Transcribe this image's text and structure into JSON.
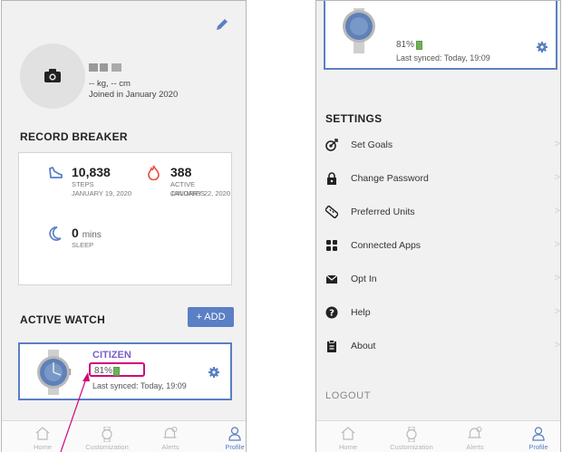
{
  "profile": {
    "stats_line": "-- kg, -- cm",
    "joined": "Joined in January 2020"
  },
  "record_breaker": {
    "title": "RECORD BREAKER",
    "steps": {
      "value": "10,838",
      "label": "STEPS",
      "date": "JANUARY 19, 2020"
    },
    "calories": {
      "value": "388",
      "label": "ACTIVE CALORIES",
      "date": "JANUARY 22, 2020"
    },
    "sleep": {
      "value": "0",
      "unit": "mins",
      "label": "SLEEP"
    }
  },
  "active_watch": {
    "title": "ACTIVE WATCH",
    "add_label": "+ ADD",
    "brand": "CITIZEN",
    "battery": "81%",
    "last_synced": "Last synced: Today, 19:09"
  },
  "settings": {
    "title": "SETTINGS",
    "items": [
      {
        "label": "Set Goals",
        "icon": "target-icon"
      },
      {
        "label": "Change Password",
        "icon": "lock-icon"
      },
      {
        "label": "Preferred Units",
        "icon": "ruler-icon"
      },
      {
        "label": "Connected Apps",
        "icon": "apps-icon"
      },
      {
        "label": "Opt In",
        "icon": "mail-icon"
      },
      {
        "label": "Help",
        "icon": "help-icon"
      },
      {
        "label": "About",
        "icon": "clipboard-icon"
      }
    ],
    "logout": "LOGOUT"
  },
  "tabbar": {
    "items": [
      "Home",
      "Customization",
      "Alerts",
      "Profile"
    ],
    "active": "Profile"
  },
  "colors": {
    "accent": "#5b7fc4",
    "highlight": "#d0087a",
    "battery": "#6fb256",
    "flame": "#e84a3c"
  }
}
